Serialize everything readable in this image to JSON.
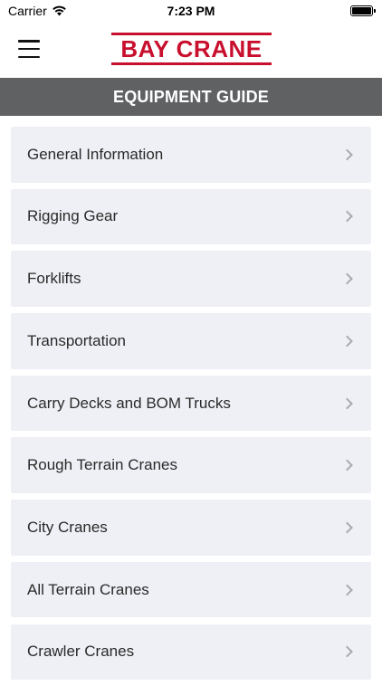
{
  "status_bar": {
    "carrier": "Carrier",
    "time": "7:23 PM"
  },
  "nav": {
    "logo_text": "BAY CRANE",
    "brand_color": "#c8102e"
  },
  "header": {
    "title": "EQUIPMENT GUIDE",
    "background": "#5f6163"
  },
  "list": {
    "items": [
      {
        "label": "General Information"
      },
      {
        "label": "Rigging Gear"
      },
      {
        "label": "Forklifts"
      },
      {
        "label": "Transportation"
      },
      {
        "label": "Carry Decks and BOM Trucks"
      },
      {
        "label": "Rough Terrain Cranes"
      },
      {
        "label": "City Cranes"
      },
      {
        "label": "All Terrain Cranes"
      },
      {
        "label": "Crawler Cranes"
      }
    ],
    "item_background": "#eef0f5",
    "chevron_icon": "chevron-right-icon"
  }
}
